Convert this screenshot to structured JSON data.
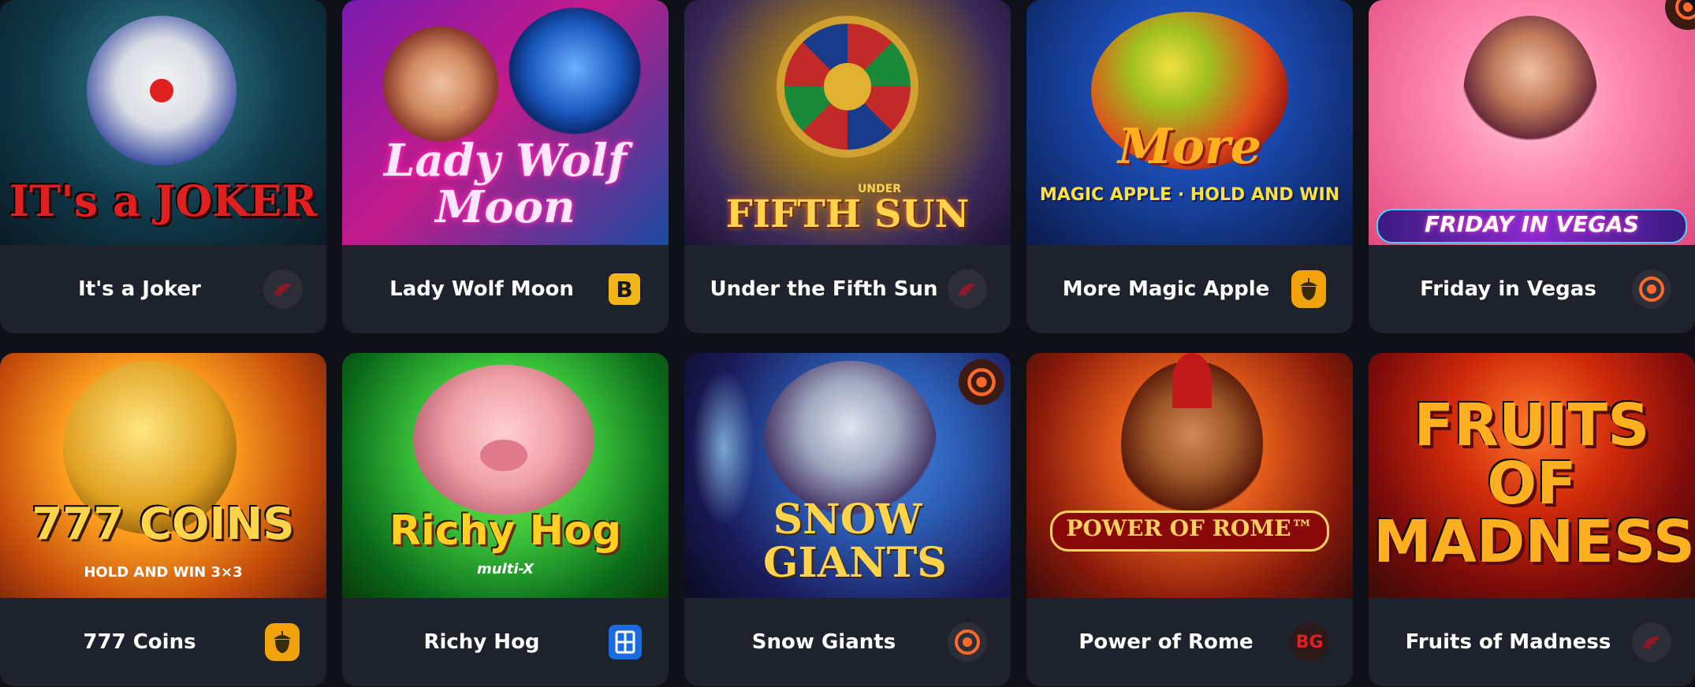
{
  "games": [
    {
      "art_title": "IT's a JOKER",
      "art_sub": "",
      "name": "It's a Joker",
      "provider_icon": "red-dragon-icon",
      "provider_label": "",
      "art_colors": [
        "#0f3a4a",
        "#2a6a7a",
        "#1a2030"
      ],
      "title_color": "#e02020"
    },
    {
      "art_title": "Lady Wolf Moon",
      "art_sub": "",
      "name": "Lady Wolf Moon",
      "provider_icon": "b-square-icon",
      "provider_label": "B",
      "art_colors": [
        "#5a1aa0",
        "#c21a8a",
        "#1a4aa0"
      ],
      "title_color": "#ffe6ff"
    },
    {
      "art_title": "FIFTH SUN",
      "art_sub": "UNDER",
      "name": "Under the Fifth Sun",
      "provider_icon": "red-dragon-icon",
      "provider_label": "",
      "art_colors": [
        "#2a1a5a",
        "#a07a1a",
        "#3a2a10"
      ],
      "title_color": "#ffd34a"
    },
    {
      "art_title": "More",
      "art_sub": "MAGIC APPLE · HOLD AND WIN",
      "name": "More Magic Apple",
      "provider_icon": "acorn-icon",
      "provider_label": "",
      "art_colors": [
        "#0a2a6a",
        "#1a4ab0",
        "#0a1a4a"
      ],
      "title_color": "#ffb020"
    },
    {
      "art_title": "FRIDAY IN VEGAS",
      "art_sub": "",
      "name": "Friday in Vegas",
      "provider_icon": "target-icon",
      "provider_label": "",
      "art_colors": [
        "#ff7aa8",
        "#ffb0c8",
        "#e04a80"
      ],
      "title_color": "#ffffff"
    },
    {
      "art_title": "777 COINS",
      "art_sub": "HOLD AND WIN 3×3",
      "name": "777 Coins",
      "provider_icon": "acorn-icon",
      "provider_label": "",
      "art_colors": [
        "#c24a0a",
        "#ffa020",
        "#6a1a0a"
      ],
      "title_color": "#ffd34a"
    },
    {
      "art_title": "Richy Hog",
      "art_sub": "multi-X",
      "name": "Richy Hog",
      "provider_icon": "bb-square-icon",
      "provider_label": "",
      "art_colors": [
        "#0a6a1a",
        "#3ac23a",
        "#0a3a0a"
      ],
      "title_color": "#ffd020"
    },
    {
      "art_title": "SNOW GIANTS",
      "art_sub": "",
      "name": "Snow Giants",
      "provider_icon": "target-icon",
      "provider_label": "",
      "art_colors": [
        "#0a1a4a",
        "#2a5ab0",
        "#1a1030"
      ],
      "title_color": "#ffd34a"
    },
    {
      "art_title": "POWER OF ROME™",
      "art_sub": "",
      "name": "Power of Rome",
      "provider_icon": "bg-text-icon",
      "provider_label": "BG",
      "art_colors": [
        "#8a1a0a",
        "#e05a1a",
        "#3a0a0a"
      ],
      "title_color": "#ffd060"
    },
    {
      "art_title": "FRUITS OF MADNESS",
      "art_sub": "",
      "name": "Fruits of Madness",
      "provider_icon": "red-dragon-icon",
      "provider_label": "",
      "art_colors": [
        "#7a0a0a",
        "#d02a0a",
        "#3a0a05"
      ],
      "title_color": "#ffb020"
    }
  ]
}
